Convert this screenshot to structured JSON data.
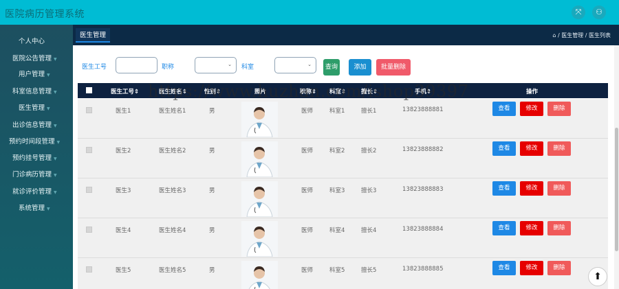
{
  "header": {
    "title": "医院病历管理系统",
    "icons": [
      "fullscreen-icon",
      "user-icon"
    ],
    "brand_color": "#00bcd4"
  },
  "sidebar": {
    "items": [
      {
        "label": "个人中心"
      },
      {
        "label": "医院公告管理"
      },
      {
        "label": "用户管理"
      },
      {
        "label": "科室信息管理"
      },
      {
        "label": "医生管理"
      },
      {
        "label": "出诊信息管理"
      },
      {
        "label": "预约时间段管理"
      },
      {
        "label": "预约挂号管理"
      },
      {
        "label": "门诊病历管理"
      },
      {
        "label": "就诊评价管理"
      },
      {
        "label": "系统管理"
      }
    ]
  },
  "tabs": {
    "active": "医生管理"
  },
  "breadcrumb": {
    "text": "/ 医生管理 / 医生列表"
  },
  "search": {
    "doctor_id_label": "医生工号",
    "title_label": "职称",
    "dept_label": "科室",
    "query_button": "查询",
    "add_button": "添加",
    "batch_delete_button": "批量删除"
  },
  "table": {
    "headers": {
      "doctor_id": "医生工号",
      "doctor_name": "医生姓名",
      "gender": "性别",
      "photo": "照片",
      "title": "职称",
      "dept": "科室",
      "specialty": "擅长",
      "phone": "手机",
      "actions": "操作"
    },
    "actions": {
      "view": "查看",
      "edit": "修改",
      "delete": "删除"
    },
    "rows": [
      {
        "doctor_id": "医生1",
        "doctor_name": "医生姓名1",
        "gender": "男",
        "title": "医师",
        "dept": "科室1",
        "specialty": "擅长1",
        "phone": "13823888881"
      },
      {
        "doctor_id": "医生2",
        "doctor_name": "医生姓名2",
        "gender": "男",
        "title": "医师",
        "dept": "科室2",
        "specialty": "擅长2",
        "phone": "13823888882"
      },
      {
        "doctor_id": "医生3",
        "doctor_name": "医生姓名3",
        "gender": "男",
        "title": "医师",
        "dept": "科室3",
        "specialty": "擅长3",
        "phone": "13823888883"
      },
      {
        "doctor_id": "医生4",
        "doctor_name": "医生姓名4",
        "gender": "男",
        "title": "医师",
        "dept": "科室4",
        "specialty": "擅长4",
        "phone": "13823888884"
      },
      {
        "doctor_id": "医生5",
        "doctor_name": "医生姓名5",
        "gender": "男",
        "title": "医师",
        "dept": "科室5",
        "specialty": "擅长5",
        "phone": "13823888885"
      }
    ]
  },
  "watermark": "https://www.huzhan.com/ishop39397",
  "colors": {
    "view": "#1e88e5",
    "edit": "#e60000",
    "delete": "#f05a5a",
    "query": "#2e9d6a",
    "add": "#1a8fd0",
    "batch_delete": "#f05a6a"
  }
}
